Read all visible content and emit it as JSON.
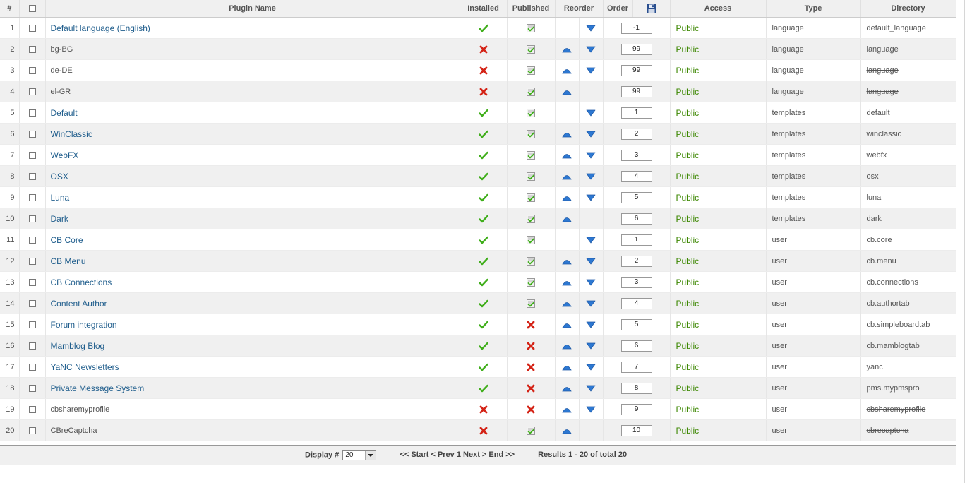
{
  "columns": {
    "num": "#",
    "name": "Plugin Name",
    "installed": "Installed",
    "published": "Published",
    "reorder": "Reorder",
    "order": "Order",
    "access": "Access",
    "type": "Type",
    "directory": "Directory"
  },
  "rows": [
    {
      "num": "1",
      "name": "Default language (English)",
      "link": true,
      "installed": true,
      "published": true,
      "up": false,
      "down": true,
      "order": "-1",
      "access": "Public",
      "type": "language",
      "directory": "default_language",
      "dir_struck": false
    },
    {
      "num": "2",
      "name": "bg-BG",
      "link": false,
      "installed": false,
      "published": true,
      "up": true,
      "down": true,
      "order": "99",
      "access": "Public",
      "type": "language",
      "directory": "language",
      "dir_struck": true
    },
    {
      "num": "3",
      "name": "de-DE",
      "link": false,
      "installed": false,
      "published": true,
      "up": true,
      "down": true,
      "order": "99",
      "access": "Public",
      "type": "language",
      "directory": "language",
      "dir_struck": true
    },
    {
      "num": "4",
      "name": "el-GR",
      "link": false,
      "installed": false,
      "published": true,
      "up": true,
      "down": false,
      "order": "99",
      "access": "Public",
      "type": "language",
      "directory": "language",
      "dir_struck": true
    },
    {
      "num": "5",
      "name": "Default",
      "link": true,
      "installed": true,
      "published": true,
      "up": false,
      "down": true,
      "order": "1",
      "access": "Public",
      "type": "templates",
      "directory": "default",
      "dir_struck": false
    },
    {
      "num": "6",
      "name": "WinClassic",
      "link": true,
      "installed": true,
      "published": true,
      "up": true,
      "down": true,
      "order": "2",
      "access": "Public",
      "type": "templates",
      "directory": "winclassic",
      "dir_struck": false
    },
    {
      "num": "7",
      "name": "WebFX",
      "link": true,
      "installed": true,
      "published": true,
      "up": true,
      "down": true,
      "order": "3",
      "access": "Public",
      "type": "templates",
      "directory": "webfx",
      "dir_struck": false
    },
    {
      "num": "8",
      "name": "OSX",
      "link": true,
      "installed": true,
      "published": true,
      "up": true,
      "down": true,
      "order": "4",
      "access": "Public",
      "type": "templates",
      "directory": "osx",
      "dir_struck": false
    },
    {
      "num": "9",
      "name": "Luna",
      "link": true,
      "installed": true,
      "published": true,
      "up": true,
      "down": true,
      "order": "5",
      "access": "Public",
      "type": "templates",
      "directory": "luna",
      "dir_struck": false
    },
    {
      "num": "10",
      "name": "Dark",
      "link": true,
      "installed": true,
      "published": true,
      "up": true,
      "down": false,
      "order": "6",
      "access": "Public",
      "type": "templates",
      "directory": "dark",
      "dir_struck": false
    },
    {
      "num": "11",
      "name": "CB Core",
      "link": true,
      "installed": true,
      "published": true,
      "up": false,
      "down": true,
      "order": "1",
      "access": "Public",
      "type": "user",
      "directory": "cb.core",
      "dir_struck": false
    },
    {
      "num": "12",
      "name": "CB Menu",
      "link": true,
      "installed": true,
      "published": true,
      "up": true,
      "down": true,
      "order": "2",
      "access": "Public",
      "type": "user",
      "directory": "cb.menu",
      "dir_struck": false
    },
    {
      "num": "13",
      "name": "CB Connections",
      "link": true,
      "installed": true,
      "published": true,
      "up": true,
      "down": true,
      "order": "3",
      "access": "Public",
      "type": "user",
      "directory": "cb.connections",
      "dir_struck": false
    },
    {
      "num": "14",
      "name": "Content Author",
      "link": true,
      "installed": true,
      "published": true,
      "up": true,
      "down": true,
      "order": "4",
      "access": "Public",
      "type": "user",
      "directory": "cb.authortab",
      "dir_struck": false
    },
    {
      "num": "15",
      "name": "Forum integration",
      "link": true,
      "installed": true,
      "published": false,
      "up": true,
      "down": true,
      "order": "5",
      "access": "Public",
      "type": "user",
      "directory": "cb.simpleboardtab",
      "dir_struck": false
    },
    {
      "num": "16",
      "name": "Mamblog Blog",
      "link": true,
      "installed": true,
      "published": false,
      "up": true,
      "down": true,
      "order": "6",
      "access": "Public",
      "type": "user",
      "directory": "cb.mamblogtab",
      "dir_struck": false
    },
    {
      "num": "17",
      "name": "YaNC Newsletters",
      "link": true,
      "installed": true,
      "published": false,
      "up": true,
      "down": true,
      "order": "7",
      "access": "Public",
      "type": "user",
      "directory": "yanc",
      "dir_struck": false
    },
    {
      "num": "18",
      "name": "Private Message System",
      "link": true,
      "installed": true,
      "published": false,
      "up": true,
      "down": true,
      "order": "8",
      "access": "Public",
      "type": "user",
      "directory": "pms.mypmspro",
      "dir_struck": false
    },
    {
      "num": "19",
      "name": "cbsharemyprofile",
      "link": false,
      "installed": false,
      "published": false,
      "up": true,
      "down": true,
      "order": "9",
      "access": "Public",
      "type": "user",
      "directory": "cbsharemyprofile",
      "dir_struck": true
    },
    {
      "num": "20",
      "name": "CBreCaptcha",
      "link": false,
      "installed": false,
      "published": true,
      "up": true,
      "down": false,
      "order": "10",
      "access": "Public",
      "type": "user",
      "directory": "cbrecaptcha",
      "dir_struck": true
    }
  ],
  "footer": {
    "display_label": "Display #",
    "display_value": "20",
    "nav": "<< Start < Prev 1 Next > End >>",
    "results": "Results 1 - 20 of total 20"
  },
  "icons": {
    "check": "green-checkmark-icon",
    "cross": "red-cross-icon",
    "published": "published-tick-icon",
    "up": "move-up-arrow-icon",
    "down": "move-down-arrow-icon",
    "save_order": "save-order-disk-icon"
  },
  "colors": {
    "link": "#1f5d8c",
    "access": "#3c8700",
    "row_alt": "#f0f0f0",
    "check": "#3fae1a",
    "cross": "#d42316",
    "arrow": "#2d78d2"
  }
}
